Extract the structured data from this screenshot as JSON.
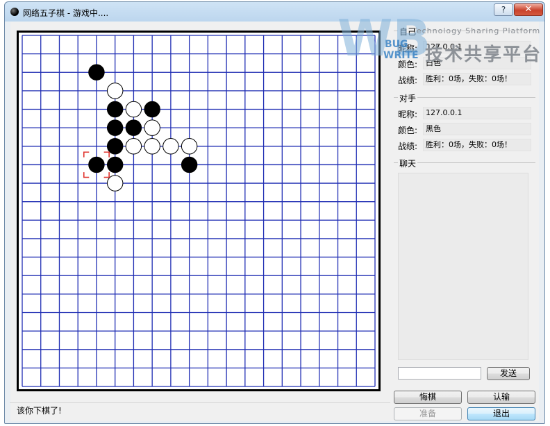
{
  "window": {
    "title": "网络五子棋 - 游戏中....",
    "help_label": "?",
    "close_label": "✕"
  },
  "board": {
    "grid_lines": 20,
    "line_color": "#1f2db3",
    "frame_color": "#000000",
    "last_move_color": "#e0322c",
    "stones": [
      {
        "col": 4,
        "row": 2,
        "color": "black"
      },
      {
        "col": 5,
        "row": 3,
        "color": "white"
      },
      {
        "col": 5,
        "row": 4,
        "color": "black"
      },
      {
        "col": 6,
        "row": 4,
        "color": "white"
      },
      {
        "col": 7,
        "row": 4,
        "color": "black"
      },
      {
        "col": 5,
        "row": 5,
        "color": "black"
      },
      {
        "col": 6,
        "row": 5,
        "color": "black"
      },
      {
        "col": 7,
        "row": 5,
        "color": "white"
      },
      {
        "col": 5,
        "row": 6,
        "color": "black"
      },
      {
        "col": 6,
        "row": 6,
        "color": "white"
      },
      {
        "col": 7,
        "row": 6,
        "color": "white"
      },
      {
        "col": 8,
        "row": 6,
        "color": "white"
      },
      {
        "col": 9,
        "row": 6,
        "color": "white"
      },
      {
        "col": 4,
        "row": 7,
        "color": "black"
      },
      {
        "col": 5,
        "row": 7,
        "color": "black"
      },
      {
        "col": 9,
        "row": 7,
        "color": "black"
      },
      {
        "col": 5,
        "row": 8,
        "color": "white"
      }
    ],
    "last_move": {
      "col": 4,
      "row": 7
    }
  },
  "self": {
    "title": "自己",
    "nick_label": "昵称:",
    "nick_value": "127.0.0.1",
    "color_label": "颜色:",
    "color_value": "白色",
    "record_label": "战绩:",
    "record_value": "胜利：0场，失败：0场！"
  },
  "opponent": {
    "title": "对手",
    "nick_label": "昵称:",
    "nick_value": "127.0.0.1",
    "color_label": "颜色:",
    "color_value": "黑色",
    "record_label": "战绩:",
    "record_value": "胜利：0场，失败：0场！"
  },
  "chat": {
    "title": "聊天",
    "input_value": "",
    "send_label": "发送"
  },
  "buttons": {
    "undo": "悔棋",
    "resign": "认输",
    "ready": "准备",
    "exit": "退出"
  },
  "status": {
    "text": "该你下棋了!"
  },
  "watermark": {
    "logo_letters": "WB",
    "logo_sub1": "BUG",
    "logo_sub2": "WRITE",
    "tagline": "Technology Sharing Platform",
    "chinese": "技术共享平台"
  }
}
